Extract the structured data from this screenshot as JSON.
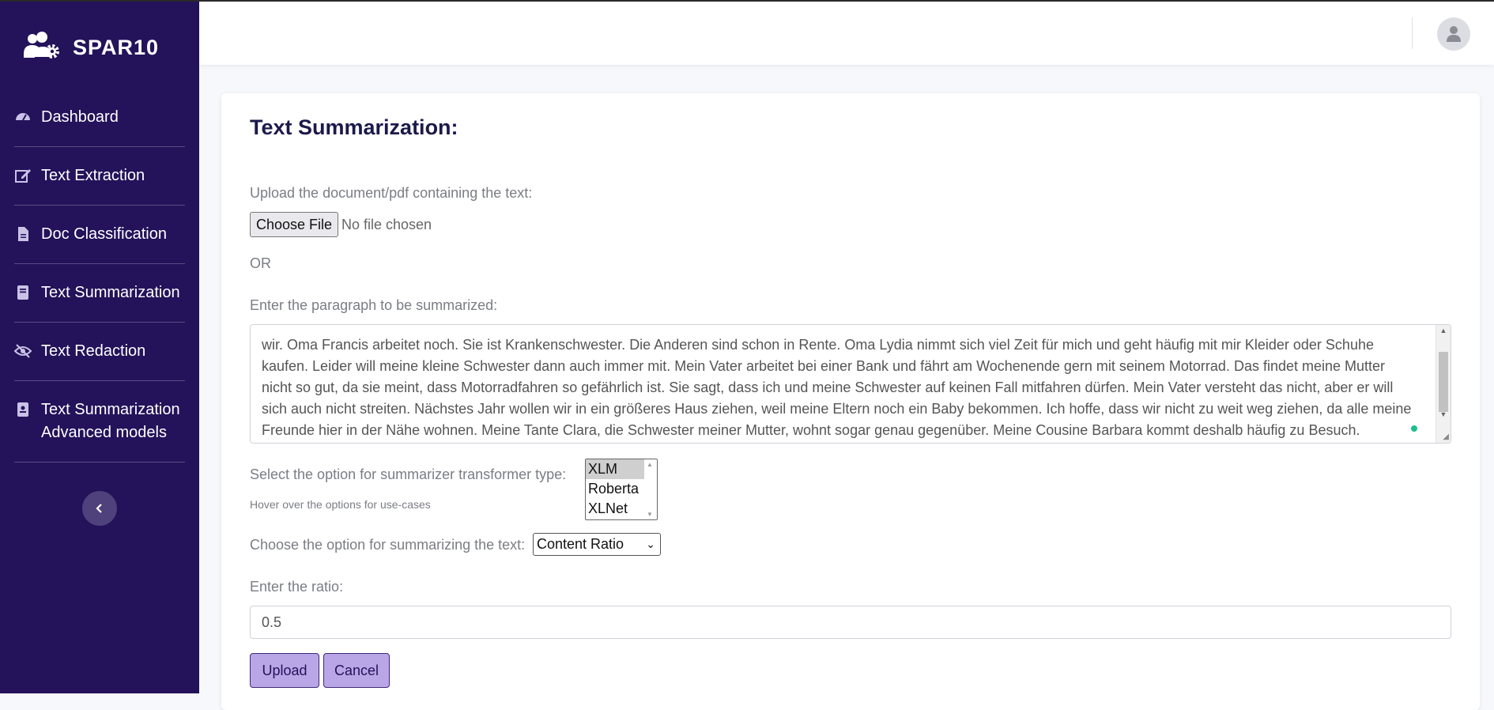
{
  "brand": {
    "name": "SPAR10",
    "icon": "users-cog-icon"
  },
  "sidebar": {
    "items": [
      {
        "label": "Dashboard",
        "icon": "speedometer-icon"
      },
      {
        "label": "Text Extraction",
        "icon": "edit-icon"
      },
      {
        "label": "Doc Classification",
        "icon": "file-icon"
      },
      {
        "label": "Text Summarization",
        "icon": "book-icon"
      },
      {
        "label": "Text Redaction",
        "icon": "eye-slash-icon"
      },
      {
        "label": "Text Summarization Advanced models",
        "icon": "id-badge-icon"
      }
    ],
    "collapse_icon": "chevron-left-icon"
  },
  "topbar": {
    "avatar_icon": "user-icon"
  },
  "form": {
    "title": "Text Summarization:",
    "upload_label": "Upload the document/pdf containing the text:",
    "choose_file": "Choose File",
    "no_file": "No file chosen",
    "or": "OR",
    "paragraph_label": "Enter the paragraph to be summarized:",
    "paragraph_lines": [
      "wir. Oma Francis arbeitet noch. Sie ist Krankenschwester. Die Anderen sind schon in Rente. Oma Lydia nimmt sich viel Zeit für mich und geht häufig mit mir Kleider oder Schuhe",
      "kaufen. Leider will meine kleine Schwester dann auch immer mit. Mein Vater arbeitet bei einer Bank und fährt am Wochenende gern mit seinem Motorrad. Das findet meine Mutter",
      "nicht so gut, da sie meint, dass Motorradfahren so gefährlich ist. Sie sagt, dass ich und meine Schwester auf keinen Fall mitfahren dürfen. Mein Vater versteht das nicht, aber er will",
      "sich auch nicht streiten. Nächstes Jahr wollen wir in ein größeres Haus ziehen, weil meine Eltern noch ein Baby bekommen. Ich hoffe, dass wir nicht zu weit weg ziehen, da alle meine",
      "Freunde hier in der Nähe wohnen. Meine Tante Clara, die Schwester meiner Mutter, wohnt sogar genau gegenüber. Meine Cousine Barbara kommt deshalb häufig zu Besuch."
    ],
    "transformer_label": "Select the option for summarizer transformer type:",
    "transformer_hint": "Hover over the options for use-cases",
    "transformer_options": [
      "XLM",
      "Roberta",
      "XLNet"
    ],
    "transformer_selected": "XLM",
    "summarize_label": "Choose the option for summarizing the text:",
    "summarize_value": "Content Ratio",
    "ratio_label": "Enter the ratio:",
    "ratio_value": "0.5",
    "upload_button": "Upload",
    "cancel_button": "Cancel"
  }
}
